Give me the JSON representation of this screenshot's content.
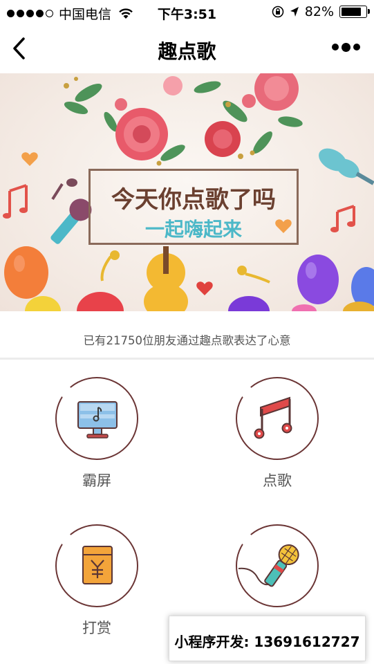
{
  "status_bar": {
    "carrier": "中国电信",
    "time": "下午3:51",
    "battery": "82%",
    "battery_level": 0.82
  },
  "nav": {
    "title": "趣点歌"
  },
  "banner": {
    "line1": "今天你点歌了吗",
    "line2": "一起嗨起来"
  },
  "counter": {
    "text": "已有21750位朋友通过趣点歌表达了心意"
  },
  "grid": [
    {
      "label": "霸屏",
      "icon": "screen-icon"
    },
    {
      "label": "点歌",
      "icon": "music-note-icon"
    },
    {
      "label": "打赏",
      "icon": "red-envelope-icon"
    },
    {
      "label": "",
      "icon": "microphone-icon"
    }
  ],
  "overlay": {
    "text": "小程序开发:  13691612727"
  },
  "colors": {
    "circle_border": "#6b3535",
    "accent_teal": "#4cb8c8",
    "banner_title": "#6b4030"
  }
}
